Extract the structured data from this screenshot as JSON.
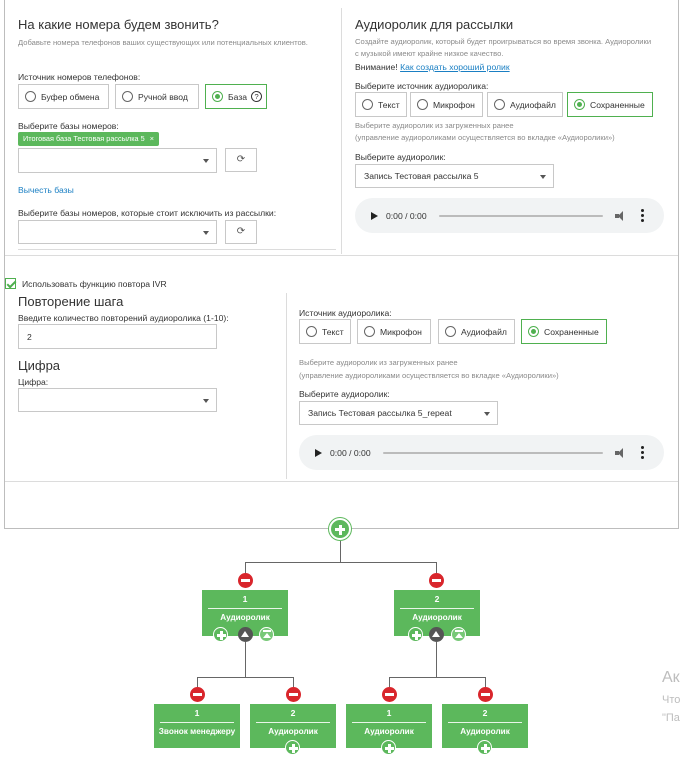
{
  "numbers_section": {
    "title": "На какие номера будем звонить?",
    "description": "Добавьте номера телефонов ваших существующих или потенциальных клиентов.",
    "source_label": "Источник номеров телефонов:",
    "sources": [
      "Буфер обмена",
      "Ручной ввод",
      "База"
    ],
    "selected_source": "База",
    "bases_label": "Выберите базы номеров:",
    "selected_base_tag": "Итоговая база Тестовая рассылка 5",
    "subtract_link": "Вычесть базы",
    "exclude_label": "Выберите базы номеров, которые стоит исключить из рассылки:"
  },
  "audio_section": {
    "title": "Аудиоролик для рассылки",
    "description": "Создайте аудиоролик, который будет проигрываться во время звонка. Аудиоролики с музыкой имеют крайне низкое качество.",
    "warning_label": "Внимание!",
    "warning_link": "Как создать хороший ролик",
    "source_label": "Выберите источник аудиоролика:",
    "sources": [
      "Текст",
      "Микрофон",
      "Аудиофайл",
      "Сохраненные"
    ],
    "selected_source": "Сохраненные",
    "hint_line1": "Выберите аудиоролик из загруженных ранее",
    "hint_line2": "(управление аудиороликами осуществляется во вкладке «Аудиоролики»)",
    "select_label": "Выберите аудиоролик:",
    "selected_audio": "Запись Тестовая рассылка 5",
    "player_time": "0:00 / 0:00"
  },
  "ivr": {
    "checkbox_label": "Использовать функцию повтора IVR",
    "repeat_title": "Повторение шага",
    "repeat_label": "Введите количество повторений аудиоролика (1-10):",
    "repeat_value": "2",
    "digit_title": "Цифра",
    "digit_label": "Цифра:",
    "source_label": "Источник аудиоролика:",
    "sources": [
      "Текст",
      "Микрофон",
      "Аудиофайл",
      "Сохраненные"
    ],
    "selected_source": "Сохраненные",
    "hint_line1": "Выберите аудиоролик из загруженных ранее",
    "hint_line2": "(управление аудиороликами осуществляется во вкладке «Аудиоролики»)",
    "select_label": "Выберите аудиоролик:",
    "selected_audio": "Запись Тестовая рассылка 5_repeat",
    "player_time": "0:00 / 0:00"
  },
  "tree": {
    "level1": [
      {
        "num": "1",
        "name": "Аудиоролик"
      },
      {
        "num": "2",
        "name": "Аудиоролик"
      }
    ],
    "level2": [
      {
        "num": "1",
        "name": "Звонок менеджеру"
      },
      {
        "num": "2",
        "name": "Аудиоролик"
      },
      {
        "num": "1",
        "name": "Аудиоролик"
      },
      {
        "num": "2",
        "name": "Аудиоролик"
      }
    ]
  },
  "side_texts": [
    "Ак",
    "Что",
    "\"Па"
  ],
  "colors": {
    "accent": "#5cb85c",
    "danger": "#d9262c",
    "link": "#1a7fc3"
  }
}
